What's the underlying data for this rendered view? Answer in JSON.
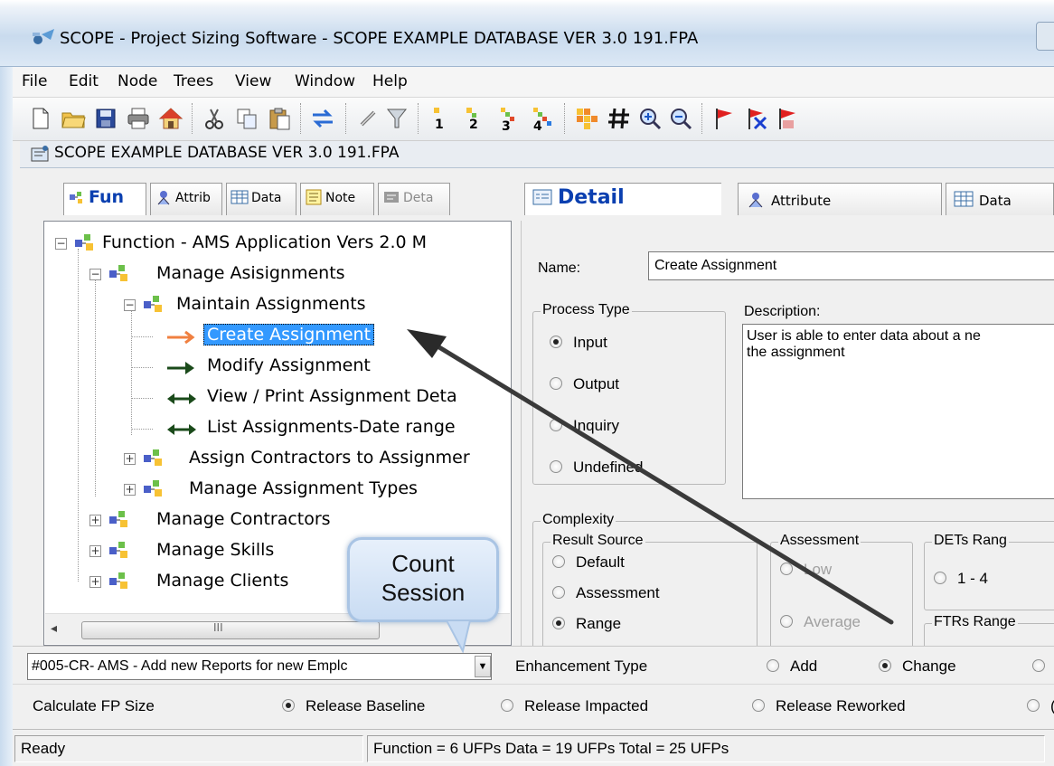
{
  "window": {
    "title": "SCOPE - Project Sizing Software  - SCOPE EXAMPLE DATABASE VER 3.0 191.FPA",
    "document_title": "SCOPE EXAMPLE DATABASE VER 3.0 191.FPA"
  },
  "menu": [
    "File",
    "Edit",
    "Node",
    "Trees",
    "View",
    "Window",
    "Help"
  ],
  "toolbar": {
    "icons": [
      "new-file-icon",
      "open-folder-icon",
      "save-icon",
      "print-icon",
      "home-icon",
      "cut-icon",
      "copy-icon",
      "paste-icon",
      "swap-icon",
      "link-icon",
      "filter-icon",
      "level-1-icon",
      "level-2-icon",
      "level-3-icon",
      "level-4-icon",
      "grid-icon",
      "hash-icon",
      "zoom-in-icon",
      "zoom-out-icon",
      "red-flag-icon",
      "remove-flag-icon",
      "flag-icon"
    ],
    "level_labels": [
      "1",
      "2",
      "3",
      "4"
    ]
  },
  "left_tabs": [
    {
      "label": "Fun",
      "icon": "function-tree-icon"
    },
    {
      "label": "Attrib",
      "icon": "attribute-icon"
    },
    {
      "label": "Data",
      "icon": "data-grid-icon"
    },
    {
      "label": "Note",
      "icon": "note-icon"
    },
    {
      "label": "Deta",
      "icon": "detail-icon"
    }
  ],
  "right_tabs": [
    {
      "label": "Detail",
      "icon": "detail-icon"
    },
    {
      "label": "Attribute",
      "icon": "attribute-icon"
    },
    {
      "label": "Data",
      "icon": "data-grid-icon"
    }
  ],
  "tree": [
    {
      "label": "Function - AMS Application  Vers 2.0  M",
      "level": 0,
      "expander": "−",
      "type": "node"
    },
    {
      "label": "Manage Asisignments",
      "level": 1,
      "expander": "−",
      "type": "node"
    },
    {
      "label": "Maintain Assignments",
      "level": 2,
      "expander": "−",
      "type": "node"
    },
    {
      "label": "Create Assignment",
      "level": 3,
      "type": "leaf",
      "arrow": "input",
      "selected": true
    },
    {
      "label": "Modify Assignment",
      "level": 3,
      "type": "leaf",
      "arrow": "output"
    },
    {
      "label": "View / Print Assignment Deta",
      "level": 3,
      "type": "leaf",
      "arrow": "inquiry"
    },
    {
      "label": "List Assignments-Date range",
      "level": 3,
      "type": "leaf",
      "arrow": "inquiry"
    },
    {
      "label": "Assign Contractors to Assignmer",
      "level": 2,
      "expander": "+",
      "type": "node"
    },
    {
      "label": "Manage Assignment Types",
      "level": 2,
      "expander": "+",
      "type": "node"
    },
    {
      "label": "Manage Contractors",
      "level": 1,
      "expander": "+",
      "type": "node"
    },
    {
      "label": "Manage Skills",
      "level": 1,
      "expander": "+",
      "type": "node"
    },
    {
      "label": "Manage Clients",
      "level": 1,
      "expander": "+",
      "type": "node"
    }
  ],
  "tree_scroll": {
    "left_arrow": "◂",
    "grip": "III"
  },
  "detail": {
    "name_label": "Name:",
    "name_value": "Create Assignment",
    "process_type": {
      "title": "Process Type",
      "options": [
        "Input",
        "Output",
        "Inquiry",
        "Undefined"
      ],
      "selected": "Input"
    },
    "description_label": "Description:",
    "description_value_line1": "User is able to enter data about a ne",
    "description_value_line2": "the assignment",
    "complexity": {
      "title": "Complexity",
      "result_source": {
        "title": "Result Source",
        "options": [
          "Default",
          "Assessment",
          "Range"
        ],
        "selected": "Range"
      },
      "assessment": {
        "title": "Assessment",
        "options": [
          "Low",
          "Average"
        ]
      },
      "dets_range": {
        "title": "DETs Rang",
        "options": [
          "1 - 4"
        ]
      },
      "ftrs_range": {
        "title": "FTRs Range"
      }
    }
  },
  "session": {
    "combo_value": "#005-CR- AMS - Add new Reports for new Emplc",
    "enhancement_label": "Enhancement Type",
    "enhancement_options": [
      "Add",
      "Change"
    ],
    "enhancement_selected": "Change"
  },
  "calculate": {
    "label": "Calculate FP Size",
    "options": [
      "Release Baseline",
      "Release Impacted",
      "Release Reworked",
      "("
    ],
    "selected": "Release Baseline"
  },
  "status": {
    "left": "Ready",
    "summary": "Function = 6 UFPs   Data = 19 UFPs   Total = 25 UFPs"
  },
  "callout": {
    "line1": "Count",
    "line2": "Session"
  },
  "colors": {
    "selection": "#3399ff",
    "tab_active_text": "#0a3fb0",
    "input_arrow": "#f08040",
    "output_arrow": "#1a4a1a",
    "inquiry_arrow": "#1a4a1a",
    "annotation_arrow": "#3a3a3a"
  }
}
